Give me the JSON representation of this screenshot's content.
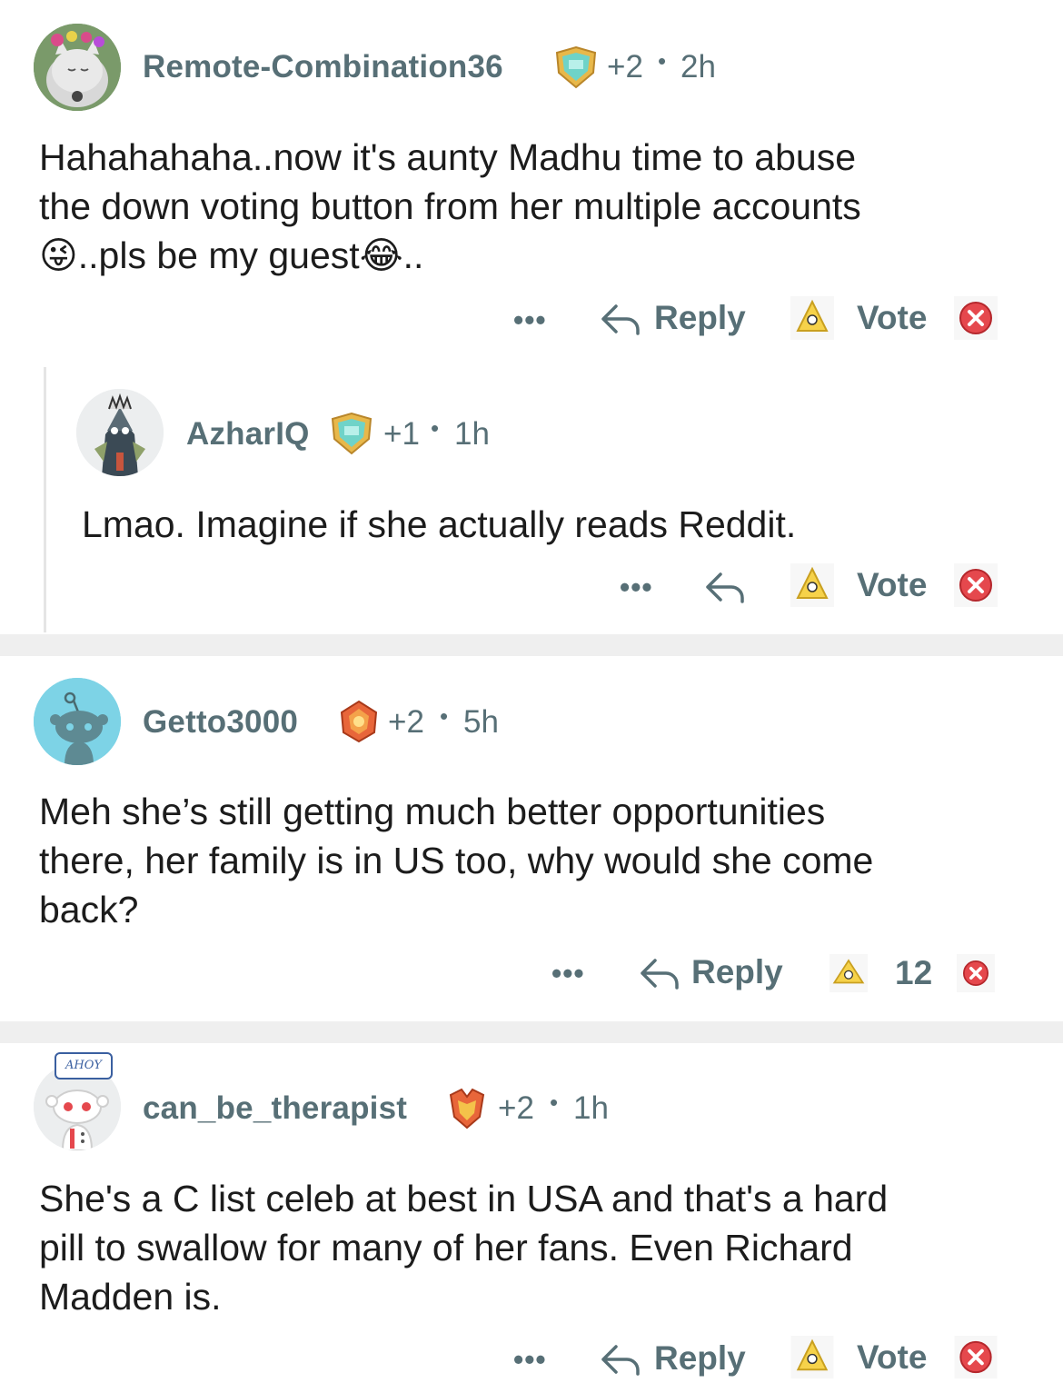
{
  "comments": [
    {
      "username": "Remote-Combination36",
      "karma": "+2",
      "dot": "•",
      "age": "2h",
      "body_line1": "Hahahahaha..now it's aunty Madhu time to abuse",
      "body_line2": "the down voting button from her multiple accounts",
      "body_line3_a": "..pls be my guest",
      "body_line3_b": "..",
      "emoji_1": "😜",
      "emoji_2": "😂",
      "more": "•••",
      "reply": "Reply",
      "vote": "Vote"
    },
    {
      "username": "AzharIQ",
      "karma": "+1",
      "dot": "•",
      "age": "1h",
      "body": "Lmao. Imagine if she actually reads Reddit.",
      "more": "•••",
      "vote": "Vote"
    },
    {
      "username": "Getto3000",
      "karma": "+2",
      "dot": "•",
      "age": "5h",
      "body_line1": "Meh she’s still getting much better opportunities",
      "body_line2": "there, her family is in US too, why would she come",
      "body_line3": "back?",
      "more": "•••",
      "reply": "Reply",
      "vote": "12"
    },
    {
      "username": "can_be_therapist",
      "karma": "+2",
      "dot": "•",
      "age": "1h",
      "body_line1": "She's a C list celeb at best in USA and that's a hard",
      "body_line2": "pill to swallow for many of her fans. Even Richard",
      "body_line3": "Madden is.",
      "more": "•••",
      "reply": "Reply",
      "vote": "Vote",
      "avatar_hat_text": "AHOY"
    }
  ],
  "colors": {
    "meta_gray": "#576f76",
    "text": "#1c1c1c",
    "separator": "#efefef",
    "thread_line": "#e5e5e5",
    "upvote_yellow": "#f6d24a",
    "downvote_red": "#e5484d",
    "getto_avatar_bg": "#7dd3e6"
  },
  "icons": [
    "reply-arrow-icon",
    "upvote-icon",
    "downvote-icon",
    "achievement-badge-icon",
    "more-dots-icon"
  ]
}
